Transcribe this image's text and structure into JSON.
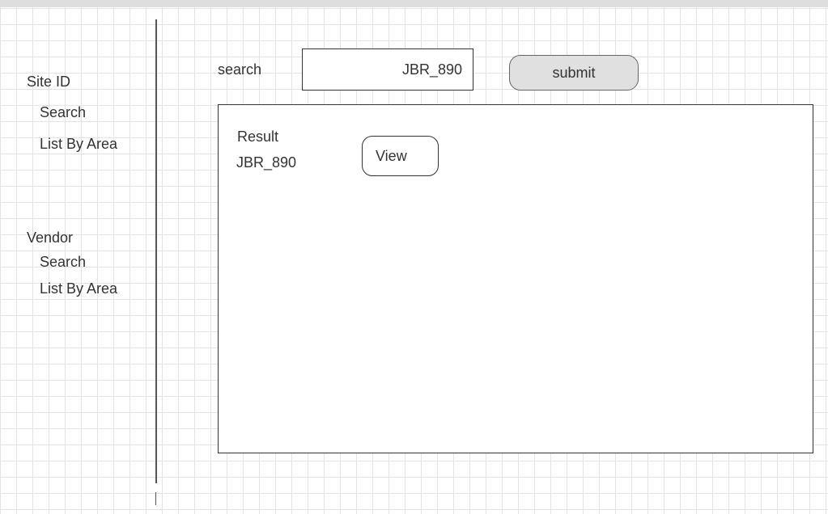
{
  "sidebar": {
    "sections": [
      {
        "heading": "Site ID",
        "items": [
          {
            "label": "Search"
          },
          {
            "label": "List By Area"
          }
        ]
      },
      {
        "heading": "Vendor",
        "items": [
          {
            "label": "Search"
          },
          {
            "label": "List By Area"
          }
        ]
      }
    ]
  },
  "search": {
    "label": "search",
    "value": "JBR_890",
    "submit_label": "submit"
  },
  "results": {
    "heading": "Result",
    "rows": [
      {
        "value": "JBR_890",
        "action_label": "View"
      }
    ]
  }
}
